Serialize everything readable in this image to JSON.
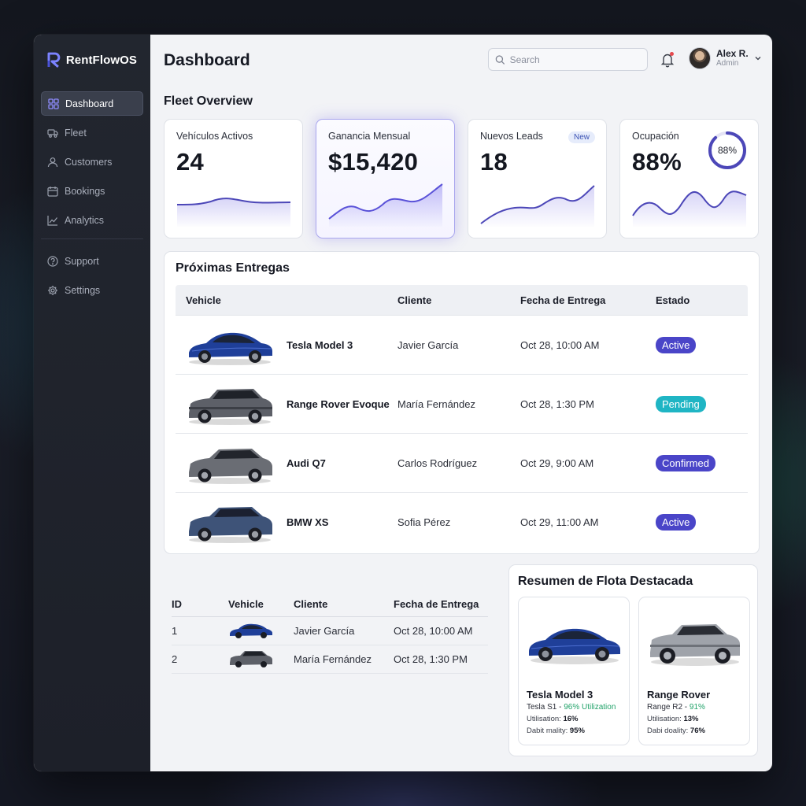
{
  "app": {
    "name": "RentFlowOS"
  },
  "sidebar": {
    "items": [
      {
        "label": "Dashboard",
        "icon": "grid-icon",
        "active": true
      },
      {
        "label": "Fleet",
        "icon": "truck-icon"
      },
      {
        "label": "Customers",
        "icon": "user-icon"
      },
      {
        "label": "Bookings",
        "icon": "calendar-icon"
      },
      {
        "label": "Analytics",
        "icon": "chart-icon"
      }
    ],
    "secondary": [
      {
        "label": "Support",
        "icon": "help-icon"
      },
      {
        "label": "Settings",
        "icon": "gear-icon"
      }
    ]
  },
  "header": {
    "title": "Dashboard",
    "search_placeholder": "Search",
    "user": {
      "name": "Alex R.",
      "role": "Admin"
    }
  },
  "overview": {
    "title": "Fleet Overview",
    "kpis": [
      {
        "label": "Vehículos Activos",
        "value": "24"
      },
      {
        "label": "Ganancia Mensual",
        "value": "$15,420"
      },
      {
        "label": "Nuevos Leads",
        "value": "18",
        "badge": "New"
      },
      {
        "label": "Ocupación",
        "value": "88%",
        "ring": "88%",
        "ring_fraction": 0.88
      }
    ]
  },
  "deliveries": {
    "title": "Próximas Entregas",
    "columns": {
      "vehicle": "Vehicle",
      "client": "Cliente",
      "date": "Fecha de Entrega",
      "status": "Estado"
    },
    "rows": [
      {
        "vehicle": "Tesla Model 3",
        "client": "Javier García",
        "date": "Oct 28, 10:00 AM",
        "status": "Active"
      },
      {
        "vehicle": "Range Rover Evoque",
        "client": "María Fernández",
        "date": "Oct 28, 1:30 PM",
        "status": "Pending"
      },
      {
        "vehicle": "Audi Q7",
        "client": "Carlos Rodríguez",
        "date": "Oct 29, 9:00 AM",
        "status": "Confirmed"
      },
      {
        "vehicle": "BMW XS",
        "client": "Sofia Pérez",
        "date": "Oct 29, 11:00 AM",
        "status": "Active"
      }
    ]
  },
  "mini_table": {
    "columns": {
      "id": "ID",
      "vehicle": "Vehicle",
      "client": "Cliente",
      "date": "Fecha de Entrega"
    },
    "rows": [
      {
        "id": "1",
        "client": "Javier García",
        "date": "Oct 28, 10:00 AM"
      },
      {
        "id": "2",
        "client": "María Fernández",
        "date": "Oct 28, 1:30 PM"
      }
    ]
  },
  "featured": {
    "title": "Resumen de Flota Destacada",
    "cards": [
      {
        "name": "Tesla Model 3",
        "sub_prefix": "Tesla S1 -",
        "sub_highlight": "96% Utilization",
        "util_label": "Utilisation:",
        "util_value": "16%",
        "metric_label": "Dabit mality:",
        "metric_value": "95%"
      },
      {
        "name": "Range Rover",
        "sub_prefix": "Range R2 -",
        "sub_highlight": "91%",
        "util_label": "Utilisation:",
        "util_value": "13%",
        "metric_label": "Dabi doality:",
        "metric_value": "76%"
      }
    ]
  },
  "colors": {
    "accent": "#5a54d6",
    "status_active": "#4a45c8",
    "status_pending": "#1fb5c4",
    "status_confirmed": "#4a45c8",
    "car_blue": "#1f3f99",
    "car_gray": "#5d6068"
  }
}
